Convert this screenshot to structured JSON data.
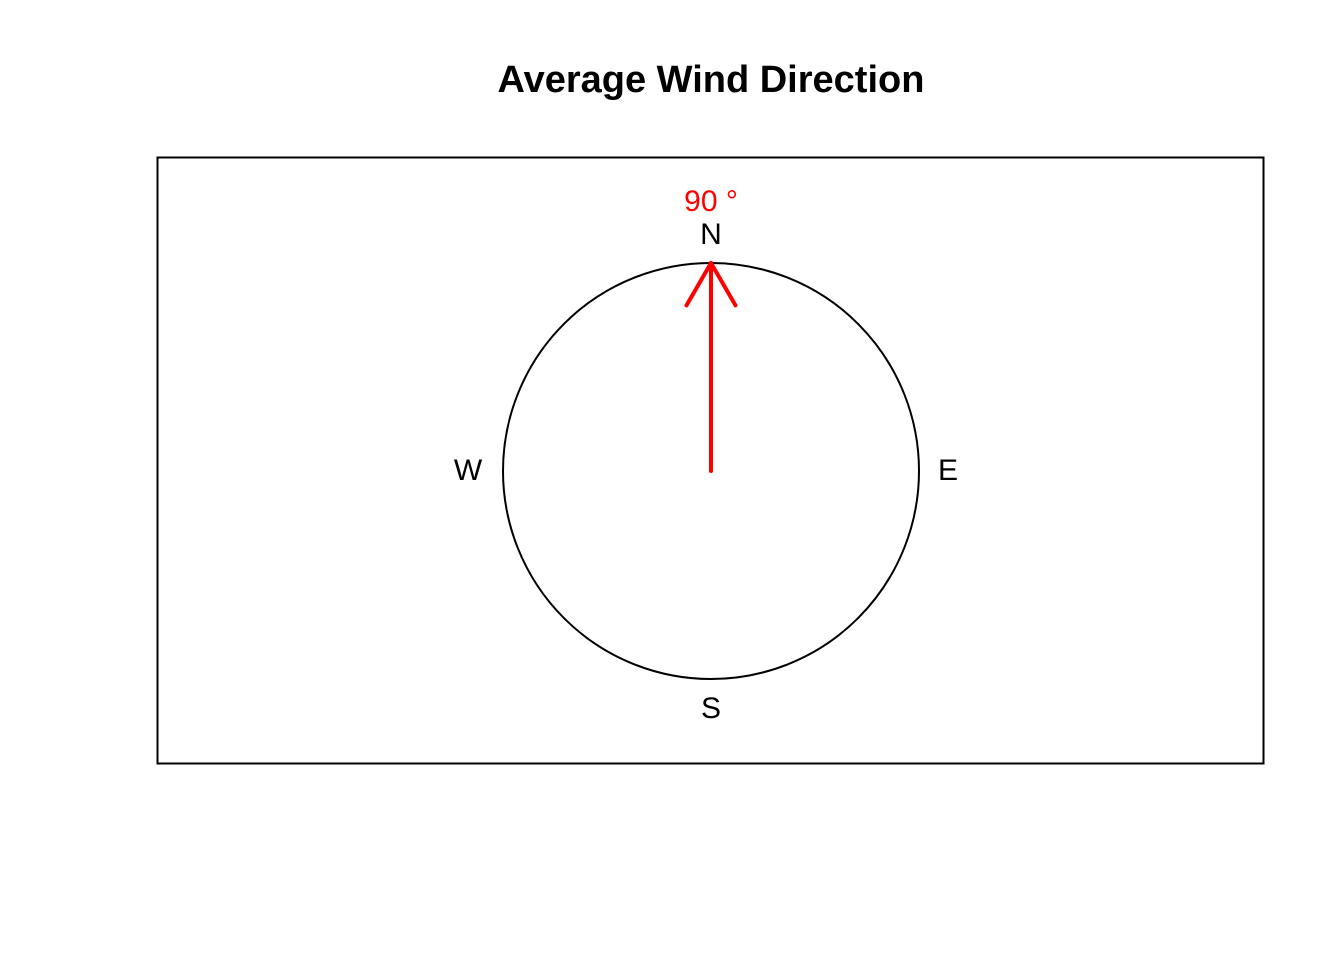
{
  "chart_data": {
    "type": "compass",
    "title": "Average Wind Direction",
    "directions": {
      "north": "N",
      "south": "S",
      "east": "E",
      "west": "W"
    },
    "direction_degrees": 90,
    "angle_label": "90 °",
    "arrow_color": "#ff0000",
    "frame": true,
    "grid": false
  }
}
